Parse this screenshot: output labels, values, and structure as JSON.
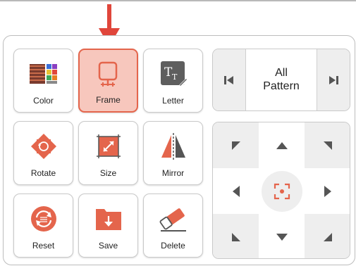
{
  "tools": [
    {
      "label": "Color",
      "icon": "color-palette-icon"
    },
    {
      "label": "Frame",
      "icon": "frame-icon",
      "active": true
    },
    {
      "label": "Letter",
      "icon": "letter-icon"
    },
    {
      "label": "Rotate",
      "icon": "rotate-icon"
    },
    {
      "label": "Size",
      "icon": "resize-icon"
    },
    {
      "label": "Mirror",
      "icon": "mirror-icon"
    },
    {
      "label": "Reset",
      "icon": "reset-icon"
    },
    {
      "label": "Save",
      "icon": "save-icon"
    },
    {
      "label": "Delete",
      "icon": "eraser-icon"
    }
  ],
  "pattern": {
    "line1": "All",
    "line2": "Pattern",
    "prev_icon": "skip-previous-icon",
    "next_icon": "skip-next-icon"
  },
  "dpad": {
    "center_icon": "center-focus-icon",
    "directions": [
      "up-left",
      "up",
      "up-right",
      "left",
      "right",
      "down-left",
      "down",
      "down-right"
    ]
  },
  "colors": {
    "accent": "#e4654c",
    "active_bg": "#f7c7bd",
    "indicator": "#e0463b",
    "icon_dark": "#555555"
  }
}
